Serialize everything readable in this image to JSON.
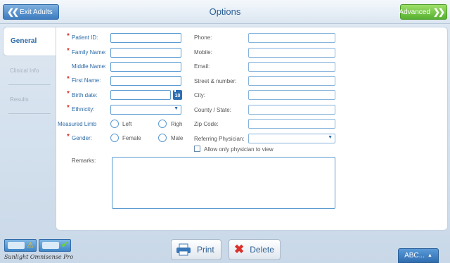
{
  "header": {
    "title": "Options",
    "exit_label": "Exit Adults",
    "advanced_label": "Advanced"
  },
  "tabs": {
    "general": "General",
    "clinical_info": "Clinical Info",
    "results": "Results"
  },
  "form": {
    "patient_id": "Patient ID:",
    "family_name": "Family Name:",
    "middle_name": "Middle Name:",
    "first_name": "First Name:",
    "birth_date": "Birth date:",
    "ethnicity": "Ethnicity:",
    "measured_limb": "Measured Limb",
    "limb_left": "Left",
    "limb_right": "Righ",
    "gender": "Gender:",
    "gender_female": "Female",
    "gender_male": "Male",
    "phone": "Phone:",
    "mobile": "Mobile:",
    "email": "Email:",
    "street": "Street & number:",
    "city": "City:",
    "county_state": "County / State:",
    "zip": "Zip Code:",
    "referring_physician": "Referring Physician:",
    "allow_only_physician": "Allow only physician to view",
    "remarks": "Remarks:",
    "calendar_day": "10",
    "required_mark": "*"
  },
  "footer": {
    "print_label": "Print",
    "delete_label": "Delete",
    "abc_label": "ABC...",
    "brand": "Sunlight Omnisense Pro"
  },
  "colors": {
    "accent_blue": "#2b6aa8",
    "required_red": "#d9322b",
    "advanced_green": "#56b030"
  }
}
